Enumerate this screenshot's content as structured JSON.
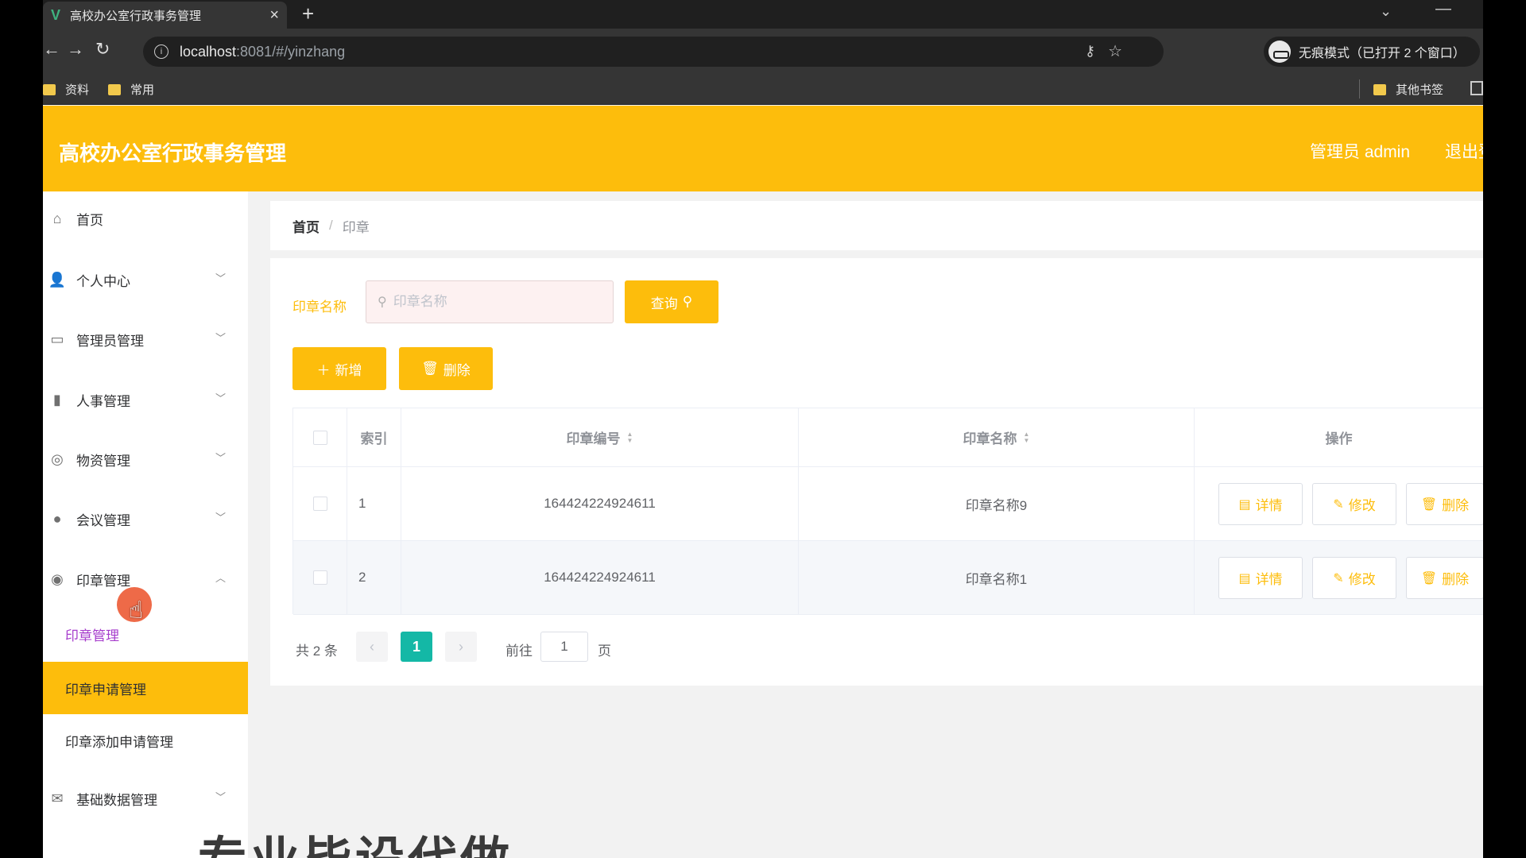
{
  "browser": {
    "tab_title": "高校办公室行政事务管理",
    "tab_close": "×",
    "new_tab": "+",
    "url_host": "localhost",
    "url_path": ":8081/#/yinzhang",
    "incognito_label": "无痕模式（已打开 2 个窗口）",
    "bookmarks": [
      {
        "label": "资料"
      },
      {
        "label": "常用"
      },
      {
        "label": "其他书签"
      }
    ]
  },
  "header": {
    "title": "高校办公室行政事务管理",
    "admin": "管理员 admin",
    "logout": "退出登录"
  },
  "sidebar": {
    "items": [
      {
        "label": "首页",
        "icon": "home-icon"
      },
      {
        "label": "个人中心",
        "icon": "user-icon"
      },
      {
        "label": "管理员管理",
        "icon": "id-card-icon"
      },
      {
        "label": "人事管理",
        "icon": "books-icon"
      },
      {
        "label": "物资管理",
        "icon": "compass-icon"
      },
      {
        "label": "会议管理",
        "icon": "lightbulb-icon"
      },
      {
        "label": "印章管理",
        "icon": "stamp-icon"
      },
      {
        "label": "基础数据管理",
        "icon": "mail-icon"
      }
    ],
    "sub_items": [
      {
        "label": "印章管理"
      },
      {
        "label": "印章申请管理"
      },
      {
        "label": "印章添加申请管理"
      }
    ]
  },
  "breadcrumb": {
    "home": "首页",
    "separator": "/",
    "current": "印章"
  },
  "search": {
    "label": "印章名称",
    "placeholder": "印章名称",
    "query_button": "查询"
  },
  "actions": {
    "add": "新增",
    "delete": "删除"
  },
  "table": {
    "headers": {
      "index": "索引",
      "code": "印章编号",
      "name": "印章名称",
      "ops": "操作"
    },
    "rows": [
      {
        "index": "1",
        "code": "164424224924611",
        "name": "印章名称9"
      },
      {
        "index": "2",
        "code": "164424224924611",
        "name": "印章名称1"
      }
    ],
    "row_buttons": {
      "detail": "详情",
      "edit": "修改",
      "delete": "删除"
    }
  },
  "pagination": {
    "total": "共 2 条",
    "current_page": "1",
    "goto_label": "前往",
    "goto_value": "1",
    "goto_suffix": "页"
  },
  "overlay_caption": "专业毕设代做",
  "colors": {
    "primary": "#fdbd0c",
    "page_active": "#14b8a6",
    "selected_text": "#a63ccc"
  }
}
